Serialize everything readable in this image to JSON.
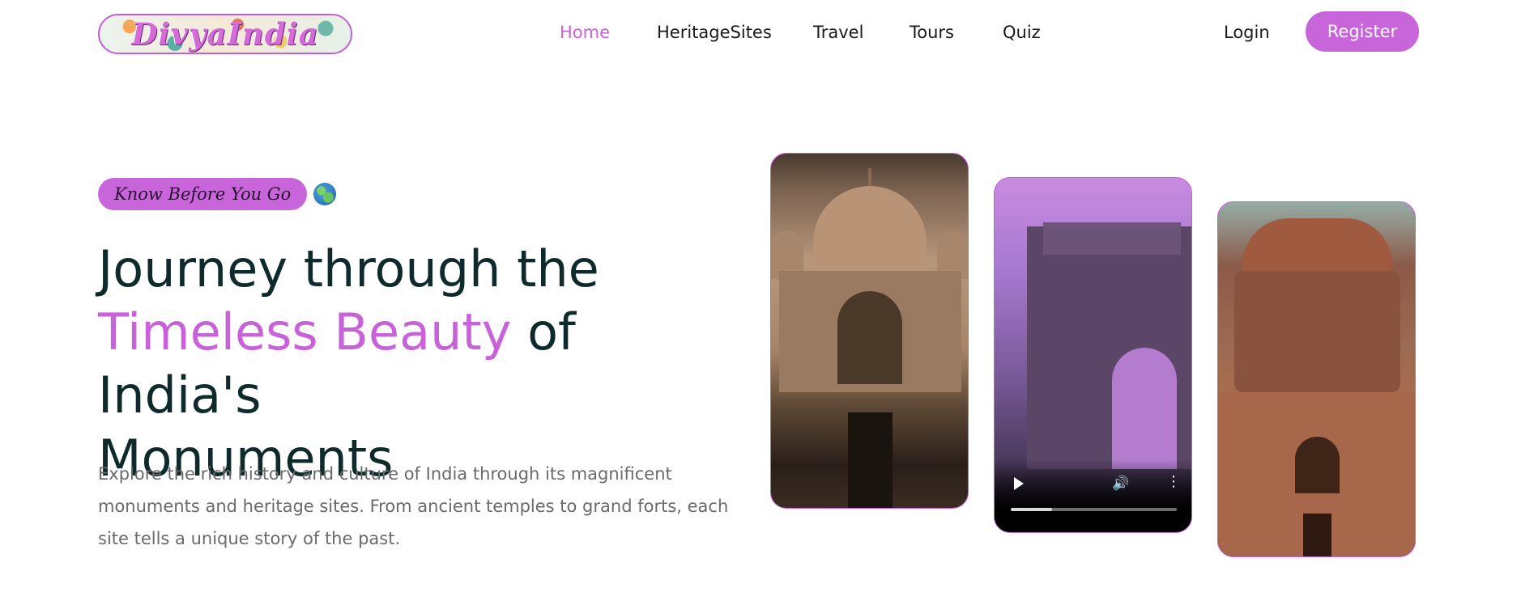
{
  "header": {
    "logo_text": "DivyaIndia",
    "nav": [
      {
        "label": "Home",
        "active": true
      },
      {
        "label": "HeritageSites",
        "active": false
      },
      {
        "label": "Travel",
        "active": false
      },
      {
        "label": "Tours",
        "active": false
      },
      {
        "label": "Quiz",
        "active": false
      }
    ],
    "login_label": "Login",
    "register_label": "Register"
  },
  "hero": {
    "tagline": "Know Before You Go",
    "tagline_icon": "globe-icon",
    "headline_part1": "Journey through the",
    "headline_accent": "Timeless Beauty",
    "headline_part2": "of India's",
    "headline_part3": "Monuments",
    "description": "Explore the rich history and culture of India through its magnificent monuments and heritage sites. From ancient temples to grand forts, each site tells a unique story of the past."
  },
  "media": {
    "video": {
      "play_icon": "play-icon",
      "volume_icon": "volume-icon",
      "more_icon": "more-options-icon",
      "progress": 0.25
    }
  },
  "colors": {
    "accent": "#c965db",
    "text_dark": "#0f2a2a",
    "text_muted": "#6a6a6a"
  }
}
